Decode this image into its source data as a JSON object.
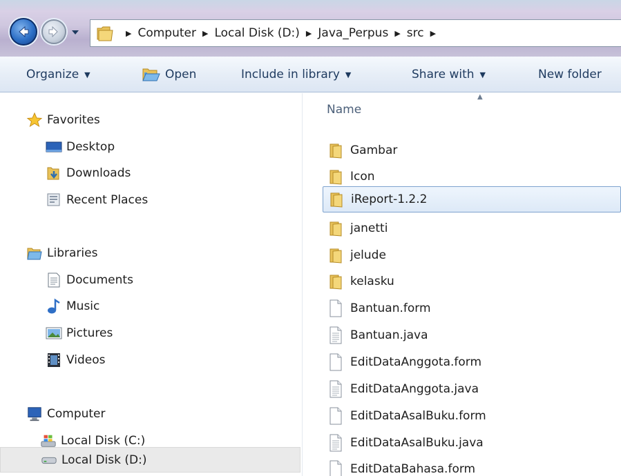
{
  "breadcrumbs": [
    "Computer",
    "Local Disk (D:)",
    "Java_Perpus",
    "src"
  ],
  "toolbar": {
    "organize": "Organize",
    "open": "Open",
    "include_library": "Include in library",
    "share_with": "Share with",
    "new_folder": "New folder"
  },
  "nav": {
    "favorites": "Favorites",
    "desktop": "Desktop",
    "downloads": "Downloads",
    "recent": "Recent Places",
    "libraries": "Libraries",
    "documents": "Documents",
    "music": "Music",
    "pictures": "Pictures",
    "videos": "Videos",
    "computer": "Computer",
    "disk_c": "Local Disk (C:)",
    "disk_d": "Local Disk (D:)"
  },
  "list": {
    "column_name": "Name",
    "items": [
      {
        "name": "Gambar",
        "type": "folder"
      },
      {
        "name": "Icon",
        "type": "folder"
      },
      {
        "name": "iReport-1.2.2",
        "type": "folder"
      },
      {
        "name": "janetti",
        "type": "folder"
      },
      {
        "name": "jelude",
        "type": "folder"
      },
      {
        "name": "kelasku",
        "type": "folder"
      },
      {
        "name": "Bantuan.form",
        "type": "file"
      },
      {
        "name": "Bantuan.java",
        "type": "text"
      },
      {
        "name": "EditDataAnggota.form",
        "type": "file"
      },
      {
        "name": "EditDataAnggota.java",
        "type": "text"
      },
      {
        "name": "EditDataAsalBuku.form",
        "type": "file"
      },
      {
        "name": "EditDataAsalBuku.java",
        "type": "text"
      },
      {
        "name": "EditDataBahasa.form",
        "type": "file"
      }
    ]
  },
  "colors": {
    "hover_border": "#7da2ce",
    "selected_bg": "#eaeaea",
    "folder": "#e8c25a"
  }
}
